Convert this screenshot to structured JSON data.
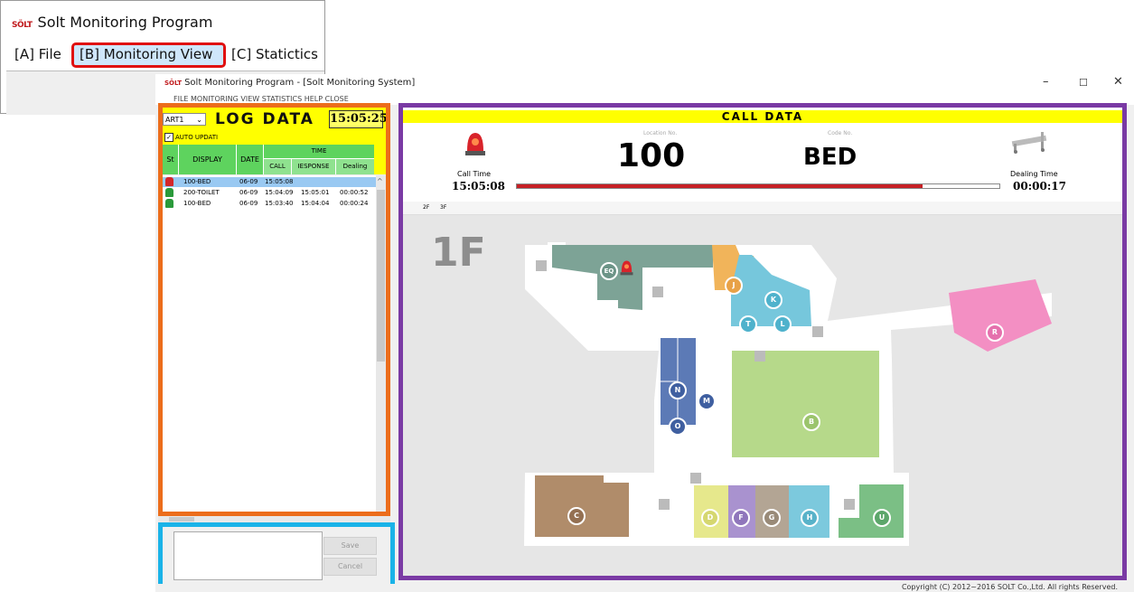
{
  "top_window": {
    "logo": "SÖLT",
    "title": "Solt Monitoring Program",
    "menu": [
      "[A] File",
      "[B] Monitoring View",
      "[C] Statictics"
    ]
  },
  "main_window": {
    "logo": "SÖLT",
    "title": "Solt Monitoring Program - [Solt Monitoring System]",
    "menu_partial": "FILE   MONITORING VIEW   STATISTICS   HELP   CLOSE",
    "minimize": "–",
    "maximize": "☐",
    "close": "✕",
    "copyright": "Copyright (C) 2012~2016 SOLT Co.,Ltd. All rights Reserved."
  },
  "log": {
    "part_select": "ART1",
    "title": "LOG DATA",
    "clock": "15:05:25",
    "auto_update_label": "AUTO UPDATI",
    "auto_update_checked": true,
    "headers": {
      "st": "St",
      "display": "DISPLAY",
      "date": "DATE",
      "time": "TIME",
      "call": "CALL",
      "response": "IESPONSE",
      "dealing": "Dealing"
    },
    "rows": [
      {
        "status": "red",
        "display": "100-BED",
        "date": "06-09",
        "call": "15:05:08",
        "response": "",
        "dealing": "",
        "selected": true
      },
      {
        "status": "green",
        "display": "200-TOILET",
        "date": "06-09",
        "call": "15:04:09",
        "response": "15:05:01",
        "dealing": "00:00:52",
        "selected": false
      },
      {
        "status": "green",
        "display": "100-BED",
        "date": "06-09",
        "call": "15:03:40",
        "response": "15:04:04",
        "dealing": "00:00:24",
        "selected": false
      }
    ],
    "save_label": "Save",
    "cancel_label": "Cancel"
  },
  "call": {
    "title": "CALL DATA",
    "location_label": "Location No.",
    "location_value": "100",
    "code_label": "Code No.",
    "code_value": "BED",
    "call_time_label": "Call Time",
    "call_time_value": "15:05:08",
    "dealing_time_label": "Dealing Time",
    "dealing_time_value": "00:00:17",
    "progress": 0.84,
    "floor_tabs": [
      "2F",
      "3F"
    ],
    "floor_label": "1F",
    "rooms": [
      "EQ",
      "J",
      "K",
      "T",
      "L",
      "N",
      "M",
      "O",
      "B",
      "C",
      "D",
      "F",
      "G",
      "H",
      "U",
      "R"
    ]
  },
  "colors": {
    "orange": "#ec6d1b",
    "blue": "#1ab3e8",
    "purple": "#7a3aa4",
    "red_highlight": "#e01010",
    "yellow": "#ffff00"
  }
}
